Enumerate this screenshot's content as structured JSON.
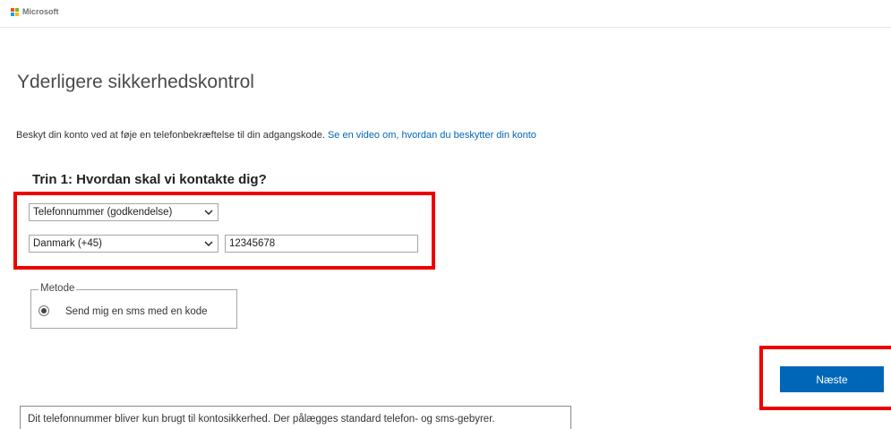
{
  "header": {
    "brand": "Microsoft",
    "logo_colors": [
      "#f25022",
      "#7fba00",
      "#00a4ef",
      "#ffb900"
    ]
  },
  "page": {
    "title": "Yderligere sikkerhedskontrol",
    "intro_text": "Beskyt din konto ved at føje en telefonbekræftelse til din adgangskode.",
    "intro_link": "Se en video om, hvordan du beskytter din konto"
  },
  "step1": {
    "title": "Trin 1: Hvordan skal vi kontakte dig?",
    "contact_method": "Telefonnummer (godkendelse)",
    "country": "Danmark (+45)",
    "phone_number": "12345678"
  },
  "method": {
    "legend": "Metode",
    "option_label": "Send mig en sms med en kode",
    "selected": true
  },
  "actions": {
    "next_label": "Næste"
  },
  "footer": {
    "note": "Dit telefonnummer bliver kun brugt til kontosikkerhed. Der pålægges standard telefon- og sms-gebyrer."
  },
  "colors": {
    "accent": "#0067b8",
    "highlight": "#ee0000"
  }
}
